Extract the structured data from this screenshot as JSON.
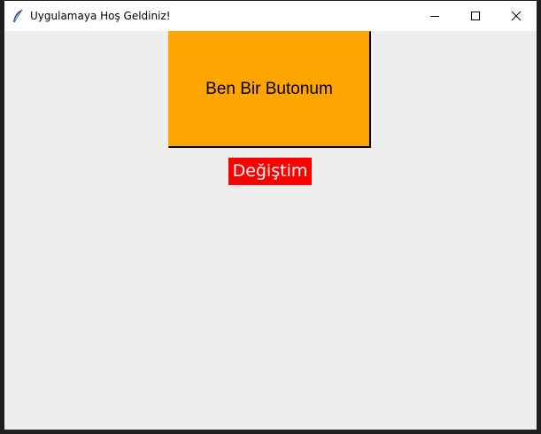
{
  "window": {
    "title": "Uygulamaya Hoş Geldiniz!",
    "app_icon": "feather-icon",
    "controls": [
      "minimize-icon",
      "maximize-icon",
      "close-icon"
    ]
  },
  "main": {
    "button_label": "Ben Bir Butonum",
    "label_text": "Değiştim"
  },
  "colors": {
    "button_bg": "#ffa500",
    "label_bg": "#ff0000",
    "label_fg": "#ffffff",
    "client_bg": "#eeeeee"
  }
}
